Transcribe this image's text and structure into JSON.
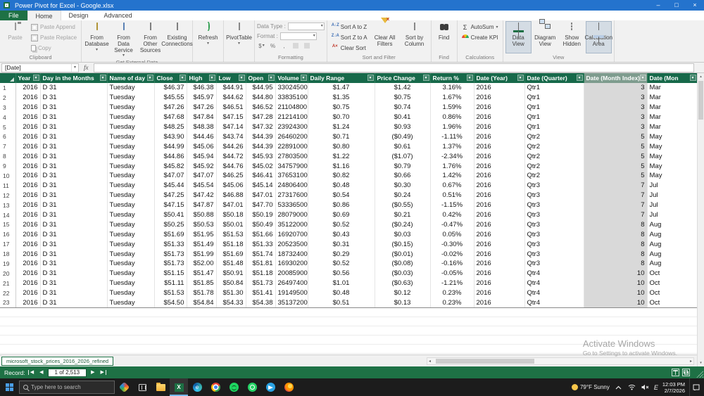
{
  "titlebar": {
    "title": "Power Pivot for Excel - Google.xlsx"
  },
  "menubar": {
    "file": "File",
    "home": "Home",
    "design": "Design",
    "advanced": "Advanced"
  },
  "ribbon": {
    "clipboard": {
      "paste": "Paste",
      "paste_append": "Paste Append",
      "paste_replace": "Paste Replace",
      "copy": "Copy",
      "group": "Clipboard"
    },
    "get_external": {
      "from_database": "From Database",
      "from_data_service": "From Data Service",
      "from_other_sources": "From Other Sources",
      "existing_connections": "Existing Connections",
      "group": "Get External Data"
    },
    "refresh": "Refresh",
    "pivottable": "PivotTable",
    "formatting": {
      "data_type": "Data Type :",
      "format": "Format :",
      "currency": "$",
      "percent": "%",
      "comma": ",",
      "group": "Formatting"
    },
    "sort_filter": {
      "az": "Sort A to Z",
      "za": "Sort Z to A",
      "clear_sort": "Clear Sort",
      "clear_filters": "Clear All Filters",
      "sort_by_col": "Sort by Column",
      "group": "Sort and Filter"
    },
    "find": {
      "label": "Find",
      "group": "Find"
    },
    "calculations": {
      "autosum": "AutoSum",
      "create_kpi": "Create KPI",
      "group": "Calculations"
    },
    "view": {
      "data_view": "Data View",
      "diagram_view": "Diagram View",
      "show_hidden": "Show Hidden",
      "calc_area": "Calculation Area",
      "group": "View"
    }
  },
  "formula_bar": {
    "name_box": "[Date]",
    "fx": "fx",
    "input": ""
  },
  "grid": {
    "columns": [
      {
        "label": "Year",
        "width": 35,
        "align": "right"
      },
      {
        "label": "Day in the Months",
        "width": 95,
        "align": "left"
      },
      {
        "label": "Name of day",
        "width": 67,
        "align": "left"
      },
      {
        "label": "Close",
        "width": 46,
        "align": "right"
      },
      {
        "label": "High",
        "width": 42,
        "align": "right"
      },
      {
        "label": "Low",
        "width": 42,
        "align": "right"
      },
      {
        "label": "Open",
        "width": 42,
        "align": "right"
      },
      {
        "label": "Volume",
        "width": 46,
        "align": "right"
      },
      {
        "label": "Daily Range",
        "width": 95,
        "align": "center"
      },
      {
        "label": "Price Change",
        "width": 79,
        "align": "center"
      },
      {
        "label": "Return %",
        "width": 62,
        "align": "center"
      },
      {
        "label": "Date (Year)",
        "width": 72,
        "align": "left"
      },
      {
        "label": "Date (Quarter)",
        "width": 84,
        "align": "left"
      },
      {
        "label": "Date (Month Index)",
        "width": 90,
        "align": "right",
        "selected": true
      },
      {
        "label": "Date (Mon",
        "width": 71,
        "align": "left"
      }
    ],
    "rows": [
      [
        "2016",
        "D 31",
        "Tuesday",
        "$46.37",
        "$46.38",
        "$44.91",
        "$44.95",
        "33024500",
        "$1.47",
        "$1.42",
        "3.16%",
        "2016",
        "Qtr1",
        "3",
        "Mar"
      ],
      [
        "2016",
        "D 31",
        "Tuesday",
        "$45.55",
        "$45.97",
        "$44.62",
        "$44.80",
        "33835100",
        "$1.35",
        "$0.75",
        "1.67%",
        "2016",
        "Qtr1",
        "3",
        "Mar"
      ],
      [
        "2016",
        "D 31",
        "Tuesday",
        "$47.26",
        "$47.26",
        "$46.51",
        "$46.52",
        "21104800",
        "$0.75",
        "$0.74",
        "1.59%",
        "2016",
        "Qtr1",
        "3",
        "Mar"
      ],
      [
        "2016",
        "D 31",
        "Tuesday",
        "$47.68",
        "$47.84",
        "$47.15",
        "$47.28",
        "21214100",
        "$0.70",
        "$0.41",
        "0.86%",
        "2016",
        "Qtr1",
        "3",
        "Mar"
      ],
      [
        "2016",
        "D 31",
        "Tuesday",
        "$48.25",
        "$48.38",
        "$47.14",
        "$47.32",
        "23924300",
        "$1.24",
        "$0.93",
        "1.96%",
        "2016",
        "Qtr1",
        "3",
        "Mar"
      ],
      [
        "2016",
        "D 31",
        "Tuesday",
        "$43.90",
        "$44.46",
        "$43.74",
        "$44.39",
        "26460200",
        "$0.71",
        "($0.49)",
        "-1.11%",
        "2016",
        "Qtr2",
        "5",
        "May"
      ],
      [
        "2016",
        "D 31",
        "Tuesday",
        "$44.99",
        "$45.06",
        "$44.26",
        "$44.39",
        "22891000",
        "$0.80",
        "$0.61",
        "1.37%",
        "2016",
        "Qtr2",
        "5",
        "May"
      ],
      [
        "2016",
        "D 31",
        "Tuesday",
        "$44.86",
        "$45.94",
        "$44.72",
        "$45.93",
        "27803500",
        "$1.22",
        "($1.07)",
        "-2.34%",
        "2016",
        "Qtr2",
        "5",
        "May"
      ],
      [
        "2016",
        "D 31",
        "Tuesday",
        "$45.82",
        "$45.92",
        "$44.76",
        "$45.02",
        "34757900",
        "$1.16",
        "$0.79",
        "1.76%",
        "2016",
        "Qtr2",
        "5",
        "May"
      ],
      [
        "2016",
        "D 31",
        "Tuesday",
        "$47.07",
        "$47.07",
        "$46.25",
        "$46.41",
        "37653100",
        "$0.82",
        "$0.66",
        "1.42%",
        "2016",
        "Qtr2",
        "5",
        "May"
      ],
      [
        "2016",
        "D 31",
        "Tuesday",
        "$45.44",
        "$45.54",
        "$45.06",
        "$45.14",
        "24806400",
        "$0.48",
        "$0.30",
        "0.67%",
        "2016",
        "Qtr3",
        "7",
        "Jul"
      ],
      [
        "2016",
        "D 31",
        "Tuesday",
        "$47.25",
        "$47.42",
        "$46.88",
        "$47.01",
        "27317600",
        "$0.54",
        "$0.24",
        "0.51%",
        "2016",
        "Qtr3",
        "7",
        "Jul"
      ],
      [
        "2016",
        "D 31",
        "Tuesday",
        "$47.15",
        "$47.87",
        "$47.01",
        "$47.70",
        "53336500",
        "$0.86",
        "($0.55)",
        "-1.15%",
        "2016",
        "Qtr3",
        "7",
        "Jul"
      ],
      [
        "2016",
        "D 31",
        "Tuesday",
        "$50.41",
        "$50.88",
        "$50.18",
        "$50.19",
        "28079000",
        "$0.69",
        "$0.21",
        "0.42%",
        "2016",
        "Qtr3",
        "7",
        "Jul"
      ],
      [
        "2016",
        "D 31",
        "Tuesday",
        "$50.25",
        "$50.53",
        "$50.01",
        "$50.49",
        "35122000",
        "$0.52",
        "($0.24)",
        "-0.47%",
        "2016",
        "Qtr3",
        "8",
        "Aug"
      ],
      [
        "2016",
        "D 31",
        "Tuesday",
        "$51.69",
        "$51.95",
        "$51.53",
        "$51.66",
        "16920700",
        "$0.43",
        "$0.03",
        "0.05%",
        "2016",
        "Qtr3",
        "8",
        "Aug"
      ],
      [
        "2016",
        "D 31",
        "Tuesday",
        "$51.33",
        "$51.49",
        "$51.18",
        "$51.33",
        "20523500",
        "$0.31",
        "($0.15)",
        "-0.30%",
        "2016",
        "Qtr3",
        "8",
        "Aug"
      ],
      [
        "2016",
        "D 31",
        "Tuesday",
        "$51.73",
        "$51.99",
        "$51.69",
        "$51.74",
        "18732400",
        "$0.29",
        "($0.01)",
        "-0.02%",
        "2016",
        "Qtr3",
        "8",
        "Aug"
      ],
      [
        "2016",
        "D 31",
        "Tuesday",
        "$51.73",
        "$52.00",
        "$51.48",
        "$51.81",
        "16930200",
        "$0.52",
        "($0.08)",
        "-0.16%",
        "2016",
        "Qtr3",
        "8",
        "Aug"
      ],
      [
        "2016",
        "D 31",
        "Tuesday",
        "$51.15",
        "$51.47",
        "$50.91",
        "$51.18",
        "20085900",
        "$0.56",
        "($0.03)",
        "-0.05%",
        "2016",
        "Qtr4",
        "10",
        "Oct"
      ],
      [
        "2016",
        "D 31",
        "Tuesday",
        "$51.11",
        "$51.85",
        "$50.84",
        "$51.73",
        "26497400",
        "$1.01",
        "($0.63)",
        "-1.21%",
        "2016",
        "Qtr4",
        "10",
        "Oct"
      ],
      [
        "2016",
        "D 31",
        "Tuesday",
        "$51.53",
        "$51.78",
        "$51.30",
        "$51.41",
        "19149500",
        "$0.48",
        "$0.12",
        "0.23%",
        "2016",
        "Qtr4",
        "10",
        "Oct"
      ],
      [
        "2016",
        "D 31",
        "Tuesday",
        "$54.50",
        "$54.84",
        "$54.33",
        "$54.38",
        "35137200",
        "$0.51",
        "$0.13",
        "0.23%",
        "2016",
        "Qtr4",
        "10",
        "Oct"
      ]
    ]
  },
  "sheet": {
    "tab": "microsoft_stock_prices_2016_2026_refined"
  },
  "status_bar": {
    "record_label": "Record:",
    "record_value": "1 of 2,513"
  },
  "watermark": {
    "line1": "Activate Windows",
    "line2": "Go to Settings to activate Windows."
  },
  "taskbar": {
    "search_placeholder": "Type here to search",
    "tray": {
      "weather": "79°F Sunny",
      "lang": "E",
      "time": "12:03 PM",
      "date": "2/7/2026"
    }
  },
  "icons": {
    "filter": "▼",
    "dropdown": "▾",
    "prev": "◀",
    "next": "▶",
    "up": "▴",
    "down": "▾",
    "left": "◂",
    "right": "▸",
    "minimize": "–",
    "maximize": "□",
    "close": "×",
    "sigma": "Σ",
    "az_badge": "A↓Z",
    "za_badge": "Z↓A",
    "clear_badge": "A×",
    "excel_letter": "X",
    "edge_letter": "e"
  }
}
